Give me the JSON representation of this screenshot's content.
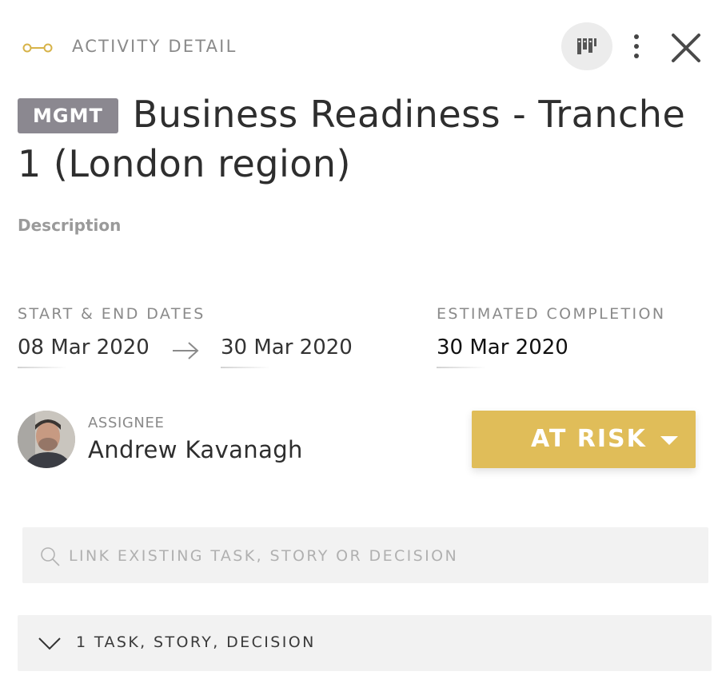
{
  "header": {
    "title": "ACTIVITY DETAIL",
    "icon": "timeline-link-icon",
    "accent": "#d7b349",
    "actions": [
      "board-view-icon",
      "more-vertical-icon",
      "close-icon"
    ]
  },
  "activity": {
    "tag": "MGMT",
    "tag_color": "#8b8890",
    "title": "Business Readiness - Tranche 1 (London region)",
    "description_label": "Description"
  },
  "dates": {
    "label": "START & END DATES",
    "start": "08 Mar 2020",
    "end": "30 Mar 2020",
    "estimated_label": "ESTIMATED COMPLETION",
    "estimated": "30 Mar 2020"
  },
  "assignee": {
    "label": "ASSIGNEE",
    "name": "Andrew Kavanagh"
  },
  "status": {
    "label": "AT RISK",
    "color": "#e0bd59"
  },
  "search": {
    "placeholder": "LINK EXISTING TASK, STORY OR DECISION",
    "value": ""
  },
  "linked": {
    "label": "1 TASK, STORY, DECISION"
  }
}
